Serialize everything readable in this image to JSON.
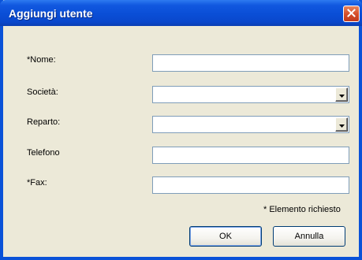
{
  "window": {
    "title": "Aggiungi utente",
    "close_icon": "close-icon"
  },
  "form": {
    "fields": [
      {
        "label": "*Nome:",
        "type": "text",
        "value": ""
      },
      {
        "label": "Società:",
        "type": "select",
        "value": ""
      },
      {
        "label": "Reparto:",
        "type": "select",
        "value": ""
      },
      {
        "label": "Telefono",
        "type": "text",
        "value": ""
      },
      {
        "label": "*Fax:",
        "type": "text",
        "value": ""
      }
    ],
    "required_note": "* Elemento richiesto"
  },
  "buttons": {
    "ok_label": "OK",
    "cancel_label": "Annulla"
  },
  "colors": {
    "titlebar": "#0A4ED6",
    "dialog_bg": "#ECE9D8",
    "close_button": "#D6502B",
    "input_border": "#7F9DB9"
  }
}
